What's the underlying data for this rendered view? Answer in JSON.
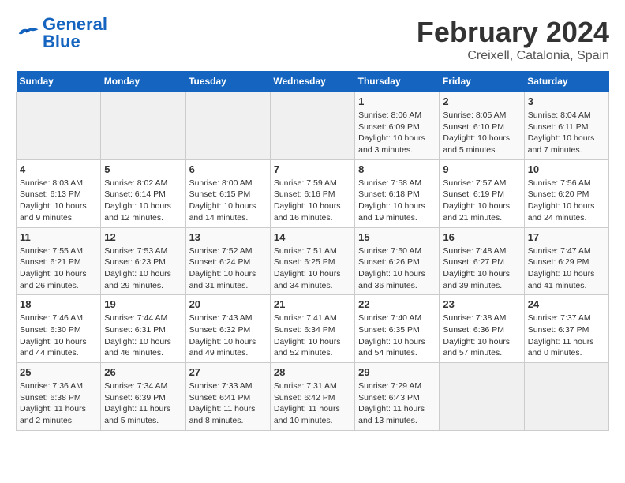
{
  "header": {
    "logo_general": "General",
    "logo_blue": "Blue",
    "month_title": "February 2024",
    "location": "Creixell, Catalonia, Spain"
  },
  "days_of_week": [
    "Sunday",
    "Monday",
    "Tuesday",
    "Wednesday",
    "Thursday",
    "Friday",
    "Saturday"
  ],
  "weeks": [
    [
      {
        "day": "",
        "info": ""
      },
      {
        "day": "",
        "info": ""
      },
      {
        "day": "",
        "info": ""
      },
      {
        "day": "",
        "info": ""
      },
      {
        "day": "1",
        "info": "Sunrise: 8:06 AM\nSunset: 6:09 PM\nDaylight: 10 hours\nand 3 minutes."
      },
      {
        "day": "2",
        "info": "Sunrise: 8:05 AM\nSunset: 6:10 PM\nDaylight: 10 hours\nand 5 minutes."
      },
      {
        "day": "3",
        "info": "Sunrise: 8:04 AM\nSunset: 6:11 PM\nDaylight: 10 hours\nand 7 minutes."
      }
    ],
    [
      {
        "day": "4",
        "info": "Sunrise: 8:03 AM\nSunset: 6:13 PM\nDaylight: 10 hours\nand 9 minutes."
      },
      {
        "day": "5",
        "info": "Sunrise: 8:02 AM\nSunset: 6:14 PM\nDaylight: 10 hours\nand 12 minutes."
      },
      {
        "day": "6",
        "info": "Sunrise: 8:00 AM\nSunset: 6:15 PM\nDaylight: 10 hours\nand 14 minutes."
      },
      {
        "day": "7",
        "info": "Sunrise: 7:59 AM\nSunset: 6:16 PM\nDaylight: 10 hours\nand 16 minutes."
      },
      {
        "day": "8",
        "info": "Sunrise: 7:58 AM\nSunset: 6:18 PM\nDaylight: 10 hours\nand 19 minutes."
      },
      {
        "day": "9",
        "info": "Sunrise: 7:57 AM\nSunset: 6:19 PM\nDaylight: 10 hours\nand 21 minutes."
      },
      {
        "day": "10",
        "info": "Sunrise: 7:56 AM\nSunset: 6:20 PM\nDaylight: 10 hours\nand 24 minutes."
      }
    ],
    [
      {
        "day": "11",
        "info": "Sunrise: 7:55 AM\nSunset: 6:21 PM\nDaylight: 10 hours\nand 26 minutes."
      },
      {
        "day": "12",
        "info": "Sunrise: 7:53 AM\nSunset: 6:23 PM\nDaylight: 10 hours\nand 29 minutes."
      },
      {
        "day": "13",
        "info": "Sunrise: 7:52 AM\nSunset: 6:24 PM\nDaylight: 10 hours\nand 31 minutes."
      },
      {
        "day": "14",
        "info": "Sunrise: 7:51 AM\nSunset: 6:25 PM\nDaylight: 10 hours\nand 34 minutes."
      },
      {
        "day": "15",
        "info": "Sunrise: 7:50 AM\nSunset: 6:26 PM\nDaylight: 10 hours\nand 36 minutes."
      },
      {
        "day": "16",
        "info": "Sunrise: 7:48 AM\nSunset: 6:27 PM\nDaylight: 10 hours\nand 39 minutes."
      },
      {
        "day": "17",
        "info": "Sunrise: 7:47 AM\nSunset: 6:29 PM\nDaylight: 10 hours\nand 41 minutes."
      }
    ],
    [
      {
        "day": "18",
        "info": "Sunrise: 7:46 AM\nSunset: 6:30 PM\nDaylight: 10 hours\nand 44 minutes."
      },
      {
        "day": "19",
        "info": "Sunrise: 7:44 AM\nSunset: 6:31 PM\nDaylight: 10 hours\nand 46 minutes."
      },
      {
        "day": "20",
        "info": "Sunrise: 7:43 AM\nSunset: 6:32 PM\nDaylight: 10 hours\nand 49 minutes."
      },
      {
        "day": "21",
        "info": "Sunrise: 7:41 AM\nSunset: 6:34 PM\nDaylight: 10 hours\nand 52 minutes."
      },
      {
        "day": "22",
        "info": "Sunrise: 7:40 AM\nSunset: 6:35 PM\nDaylight: 10 hours\nand 54 minutes."
      },
      {
        "day": "23",
        "info": "Sunrise: 7:38 AM\nSunset: 6:36 PM\nDaylight: 10 hours\nand 57 minutes."
      },
      {
        "day": "24",
        "info": "Sunrise: 7:37 AM\nSunset: 6:37 PM\nDaylight: 11 hours\nand 0 minutes."
      }
    ],
    [
      {
        "day": "25",
        "info": "Sunrise: 7:36 AM\nSunset: 6:38 PM\nDaylight: 11 hours\nand 2 minutes."
      },
      {
        "day": "26",
        "info": "Sunrise: 7:34 AM\nSunset: 6:39 PM\nDaylight: 11 hours\nand 5 minutes."
      },
      {
        "day": "27",
        "info": "Sunrise: 7:33 AM\nSunset: 6:41 PM\nDaylight: 11 hours\nand 8 minutes."
      },
      {
        "day": "28",
        "info": "Sunrise: 7:31 AM\nSunset: 6:42 PM\nDaylight: 11 hours\nand 10 minutes."
      },
      {
        "day": "29",
        "info": "Sunrise: 7:29 AM\nSunset: 6:43 PM\nDaylight: 11 hours\nand 13 minutes."
      },
      {
        "day": "",
        "info": ""
      },
      {
        "day": "",
        "info": ""
      }
    ]
  ]
}
